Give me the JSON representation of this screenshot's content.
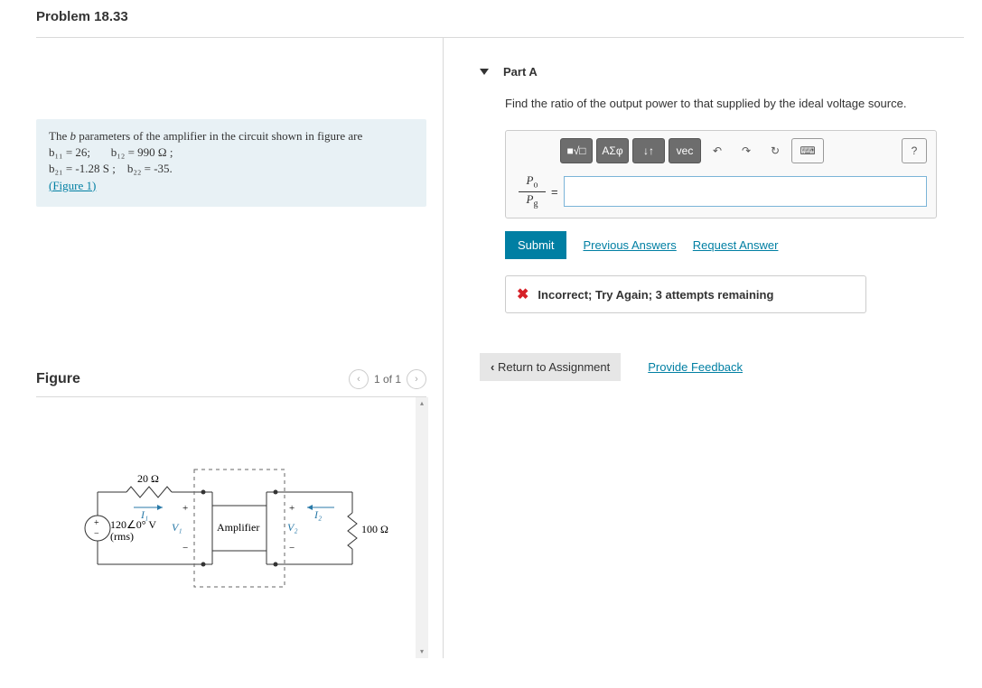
{
  "problem": {
    "title": "Problem 18.33"
  },
  "info": {
    "line1_pre": "The ",
    "line1_i": "b",
    "line1_post": " parameters of the amplifier in the circuit shown in figure are",
    "b11": "b₁₁ = 26;",
    "b12": "b₁₂ = 990 Ω ;",
    "b21": "b₂₁ = -1.28 S ;",
    "b22": "b₂₂ = -35.",
    "figlink": "(Figure 1)"
  },
  "figure": {
    "title": "Figure",
    "pager": "1 of 1",
    "labels": {
      "r_in": "20 Ω",
      "i1": "I₁",
      "src": "120∠0° V",
      "rms": "(rms)",
      "v1": "V₁",
      "amp": "Amplifier",
      "v2": "V₂",
      "i2": "I₂",
      "r_out": "100 Ω"
    }
  },
  "part": {
    "title": "Part A",
    "prompt": "Find the ratio of the output power to that supplied by the ideal voltage source.",
    "ratio_num": "Pₒ",
    "ratio_den": "P₉",
    "eq": "=",
    "toolbar": {
      "templates": "■√□",
      "greek": "ΑΣφ",
      "subsup": "↓↑",
      "vec": "vec",
      "help": "?"
    }
  },
  "actions": {
    "submit": "Submit",
    "prev": "Previous Answers",
    "request": "Request Answer"
  },
  "feedback": {
    "icon": "✖",
    "msg": "Incorrect; Try Again; 3 attempts remaining"
  },
  "footer": {
    "return": "Return to Assignment",
    "provide": "Provide Feedback"
  }
}
